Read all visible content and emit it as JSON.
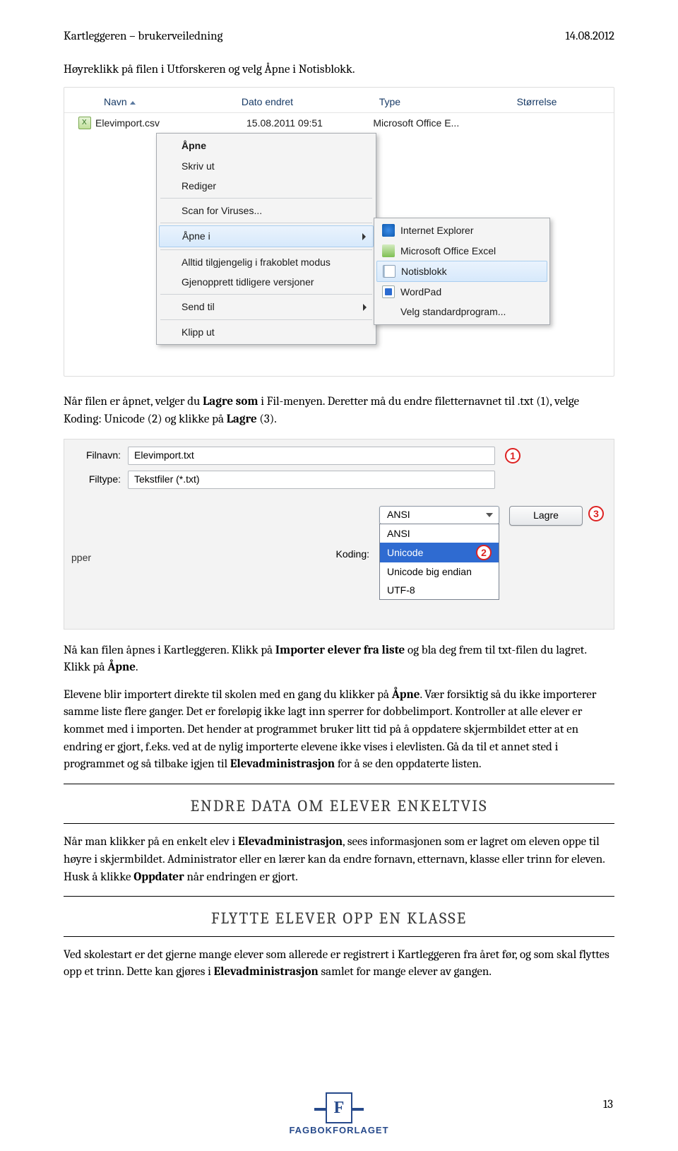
{
  "header": {
    "left": "Kartleggeren – brukerveiledning",
    "right": "14.08.2012"
  },
  "intro": "Høyreklikk på filen i Utforskeren og velg Åpne i Notisblokk.",
  "explorer": {
    "columns": {
      "name": "Navn",
      "date": "Dato endret",
      "type": "Type",
      "size": "Størrelse"
    },
    "file": {
      "name": "Elevimport.csv",
      "date": "15.08.2011 09:51",
      "type": "Microsoft Office E..."
    }
  },
  "context_menu": {
    "items": [
      "Åpne",
      "Skriv ut",
      "Rediger",
      "Scan for Viruses...",
      "Åpne i",
      "Alltid tilgjengelig i frakoblet modus",
      "Gjenopprett tidligere versjoner",
      "Send til",
      "Klipp ut"
    ]
  },
  "sub_menu": {
    "items": [
      "Internet Explorer",
      "Microsoft Office Excel",
      "Notisblokk",
      "WordPad",
      "Velg standardprogram..."
    ]
  },
  "save_para_prefix": "Når filen er åpnet, velger du ",
  "save_para_bold1": "Lagre som",
  "save_para_mid": " i Fil-menyen. Deretter må du endre filetternavnet til .txt (1), velge Koding: Unicode (2) og klikke på ",
  "save_para_bold2": "Lagre",
  "save_para_suffix": " (3).",
  "dialog": {
    "filnavn_label": "Filnavn:",
    "filnavn_value": "Elevimport.txt",
    "filtype_label": "Filtype:",
    "filtype_value": "Tekstfiler (*.txt)",
    "pper": "pper",
    "koding_label": "Koding:",
    "koding_value": "ANSI",
    "options": [
      "ANSI",
      "Unicode",
      "Unicode big endian",
      "UTF-8"
    ],
    "lagre": "Lagre",
    "badge1": "1",
    "badge2": "2",
    "badge3": "3"
  },
  "para_na": {
    "t1": "Nå kan filen åpnes i Kartleggeren. Klikk på ",
    "b1": "Importer elever fra liste",
    "t2": " og bla deg frem til txt-filen du lagret. Klikk på ",
    "b2": "Åpne",
    "t3": "."
  },
  "para_elev": {
    "t1": "Elevene blir importert direkte til skolen med en gang du klikker på ",
    "b1": "Åpne",
    "t2": ". Vær forsiktig så du ikke importerer samme liste flere ganger. Det er foreløpig ikke lagt inn sperrer for dobbelimport. Kontroller at alle elever er kommet med i importen. Det hender at programmet bruker litt tid på å oppdatere skjermbildet etter at en endring er gjort, f.eks. ved at de nylig importerte elevene ikke vises i elevlisten. Gå da til et annet sted i programmet og så tilbake igjen til ",
    "b2": "Elevadministrasjon",
    "t3": " for å se den oppdaterte listen."
  },
  "heading1": "ENDRE DATA OM ELEVER ENKELTVIS",
  "para_endre": {
    "t1": "Når man klikker på en enkelt elev i ",
    "b1": "Elevadministrasjon",
    "t2": ", sees informasjonen som er lagret om eleven oppe til høyre i skjermbildet. Administrator eller en lærer kan da endre fornavn, etternavn, klasse eller trinn for eleven. Husk å klikke ",
    "b2": "Oppdater",
    "t3": " når endringen er gjort."
  },
  "heading2": "FLYTTE ELEVER OPP EN KLASSE",
  "para_flytte": {
    "t1": "Ved skolestart er det gjerne mange elever som allerede er registrert i Kartleggeren fra året før, og som skal flyttes opp et trinn. Dette kan gjøres i ",
    "b1": "Elevadministrasjon",
    "t2": " samlet for mange elever av gangen."
  },
  "footer": {
    "logo_letter": "F",
    "brand": "FAGBOKFORLAGET",
    "page": "13"
  }
}
